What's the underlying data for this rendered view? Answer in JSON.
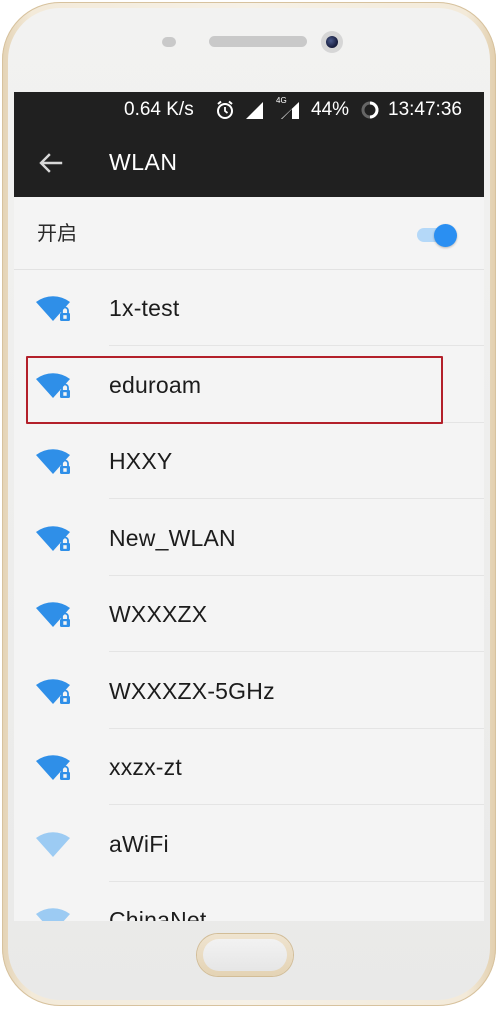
{
  "status_bar": {
    "speed": "0.64 K/s",
    "network_type": "4G",
    "battery": "44%",
    "time": "13:47:36"
  },
  "header": {
    "title": "WLAN"
  },
  "wlan_toggle": {
    "label": "开启",
    "state": "on"
  },
  "networks": [
    {
      "ssid": "1x-test",
      "secured": true,
      "signal": "strong"
    },
    {
      "ssid": "eduroam",
      "secured": true,
      "signal": "strong"
    },
    {
      "ssid": "HXXY",
      "secured": true,
      "signal": "strong"
    },
    {
      "ssid": "New_WLAN",
      "secured": true,
      "signal": "strong"
    },
    {
      "ssid": "WXXXZX",
      "secured": true,
      "signal": "strong"
    },
    {
      "ssid": "WXXXZX-5GHz",
      "secured": true,
      "signal": "strong"
    },
    {
      "ssid": "xxzx-zt",
      "secured": true,
      "signal": "strong"
    },
    {
      "ssid": "aWiFi",
      "secured": false,
      "signal": "weak"
    },
    {
      "ssid": "ChinaNet",
      "secured": false,
      "signal": "weak"
    }
  ],
  "highlighted_network": "eduroam",
  "colors": {
    "accent": "#2A8FF2",
    "wifi_strong": "#2F8FE8",
    "wifi_weak": "#9CCBF3",
    "app_bar": "#202020",
    "highlight_border": "#B3202A",
    "phone_frame": "#E9DCC3"
  },
  "icons": {
    "back": "arrow-left-icon",
    "alarm": "alarm-clock-icon",
    "signal": "cell-signal-icon",
    "battery": "battery-ring-icon",
    "wifi_locked": "wifi-lock-icon",
    "wifi_open": "wifi-icon"
  }
}
